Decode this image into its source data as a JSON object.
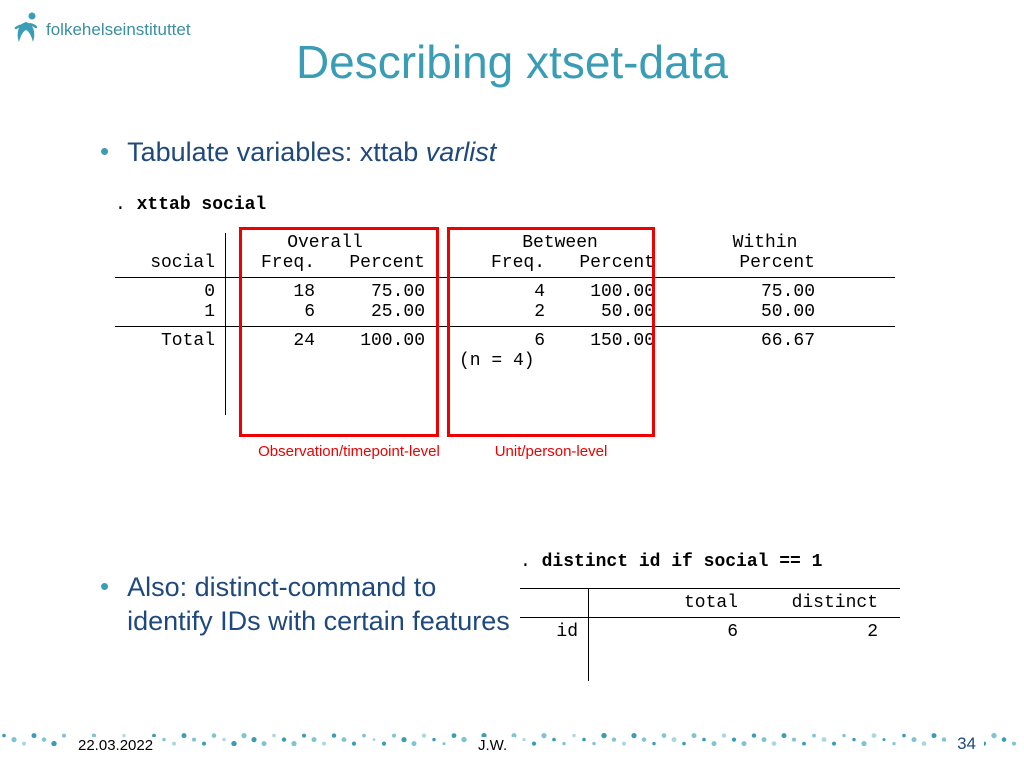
{
  "logo": {
    "text": "folkehelseinstituttet"
  },
  "title": "Describing xtset-data",
  "bullets": {
    "b1_prefix": "Tabulate variables: xttab ",
    "b1_var": "varlist",
    "b2": "Also: distinct-command to identify IDs with certain features"
  },
  "xttab": {
    "cmd_prefix": ". ",
    "cmd": "xttab social",
    "rowlabel": "social",
    "cols": {
      "overall": "Overall",
      "between": "Between",
      "within": "Within",
      "freq": "Freq.",
      "percent": "Percent"
    },
    "rows": [
      {
        "label": "0",
        "ofreq": "18",
        "opct": "75.00",
        "bfreq": "4",
        "bpct": "100.00",
        "wpct": "75.00"
      },
      {
        "label": "1",
        "ofreq": "6",
        "opct": "25.00",
        "bfreq": "2",
        "bpct": "50.00",
        "wpct": "50.00"
      }
    ],
    "total": {
      "label": "Total",
      "ofreq": "24",
      "opct": "100.00",
      "bfreq": "6",
      "bpct": "150.00",
      "wpct": "66.67"
    },
    "n_note": "(n = 4)",
    "caption_overall": "Observation/timepoint-level",
    "caption_between": "Unit/person-level"
  },
  "distinct": {
    "cmd_prefix": ". ",
    "cmd": "distinct id if social == 1",
    "cols": {
      "total": "total",
      "distinct": "distinct"
    },
    "row": {
      "label": "id",
      "total": "6",
      "distinct": "2"
    }
  },
  "footer": {
    "date": "22.03.2022",
    "author": "J.W.",
    "page": "34"
  },
  "chart_data": {
    "type": "table",
    "tables": [
      {
        "name": "xttab social",
        "columns": [
          "social",
          "Overall Freq.",
          "Overall Percent",
          "Between Freq.",
          "Between Percent",
          "Within Percent"
        ],
        "rows": [
          [
            "0",
            18,
            75.0,
            4,
            100.0,
            75.0
          ],
          [
            "1",
            6,
            25.0,
            2,
            50.0,
            50.0
          ],
          [
            "Total",
            24,
            100.0,
            6,
            150.0,
            66.67
          ]
        ],
        "note": "n = 4"
      },
      {
        "name": "distinct id if social == 1",
        "columns": [
          "",
          "total",
          "distinct"
        ],
        "rows": [
          [
            "id",
            6,
            2
          ]
        ]
      }
    ]
  }
}
